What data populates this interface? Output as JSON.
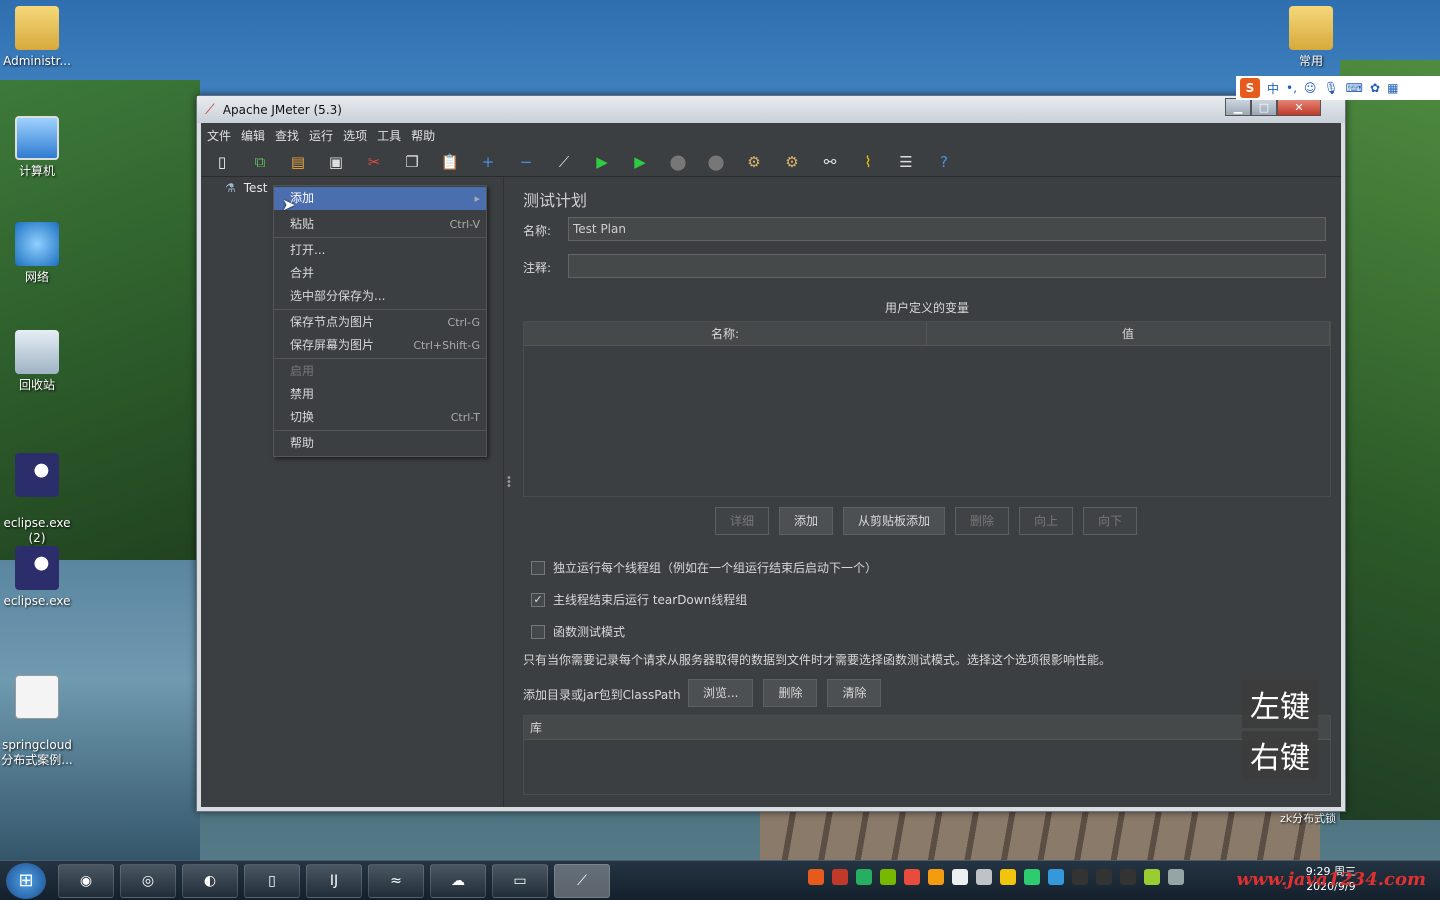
{
  "desktop": {
    "icons": [
      {
        "label": "Administr..."
      },
      {
        "label": "计算机"
      },
      {
        "label": "网络"
      },
      {
        "label": "回收站"
      },
      {
        "label": "eclipse.exe\n(2)"
      },
      {
        "label": "eclipse.exe"
      },
      {
        "label": "springcloud\n分布式案例..."
      },
      {
        "label": "常用"
      }
    ],
    "caption": "zk分布式锁"
  },
  "window": {
    "title": "Apache JMeter (5.3)",
    "menu": [
      "文件",
      "编辑",
      "查找",
      "运行",
      "选项",
      "工具",
      "帮助"
    ]
  },
  "tree": {
    "root_label": "Test"
  },
  "context_menu": {
    "items": [
      {
        "label": "添加",
        "shortcut": "",
        "state": "active"
      },
      {
        "label": "粘贴",
        "shortcut": "Ctrl-V",
        "state": "normal"
      },
      {
        "label": "打开...",
        "shortcut": "",
        "state": "normal"
      },
      {
        "label": "合并",
        "shortcut": "",
        "state": "normal"
      },
      {
        "label": "选中部分保存为...",
        "shortcut": "",
        "state": "normal"
      },
      {
        "label": "保存节点为图片",
        "shortcut": "Ctrl-G",
        "state": "normal"
      },
      {
        "label": "保存屏幕为图片",
        "shortcut": "Ctrl+Shift-G",
        "state": "normal"
      },
      {
        "label": "启用",
        "shortcut": "",
        "state": "disabled"
      },
      {
        "label": "禁用",
        "shortcut": "",
        "state": "normal"
      },
      {
        "label": "切换",
        "shortcut": "Ctrl-T",
        "state": "normal"
      },
      {
        "label": "帮助",
        "shortcut": "",
        "state": "normal"
      }
    ]
  },
  "test_plan": {
    "title": "测试计划",
    "name_label": "名称:",
    "name_value": "Test Plan",
    "comment_label": "注释:",
    "comment_value": "",
    "vars_title": "用户定义的变量",
    "vars_columns": [
      "名称:",
      "值"
    ],
    "buttons": {
      "detail": "详细",
      "add": "添加",
      "add_from_clipboard": "从剪贴板添加",
      "delete": "删除",
      "up": "向上",
      "down": "向下"
    },
    "options": [
      {
        "label": "独立运行每个线程组（例如在一个组运行结束后启动下一个）",
        "checked": false
      },
      {
        "label": "主线程结束后运行 tearDown线程组",
        "checked": true
      },
      {
        "label": "函数测试模式",
        "checked": false
      }
    ],
    "functional_note": "只有当你需要记录每个请求从服务器取得的数据到文件时才需要选择函数测试模式。选择这个选项很影响性能。",
    "classpath_label": "添加目录或jar包到ClassPath",
    "classpath_buttons": {
      "browse": "浏览...",
      "delete": "删除",
      "clear": "清除"
    },
    "library_header": "库"
  },
  "overlay": {
    "left_key": "左键",
    "right_key": "右键"
  },
  "ime": {
    "logo": "S",
    "mode": "中"
  },
  "taskbar": {
    "clock_time": "9:29 周三",
    "clock_date": "2020/9/9",
    "watermark": "www.java1234.com"
  }
}
